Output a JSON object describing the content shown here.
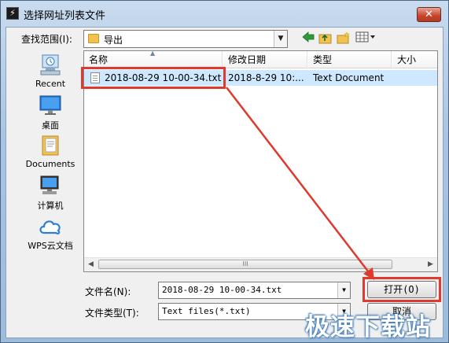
{
  "window": {
    "title": "选择网址列表文件",
    "close_glyph": "✕",
    "app_icon_glyph": "⚡"
  },
  "lookin": {
    "label": "查找范围(I):",
    "value": "导出"
  },
  "toolbar": {
    "back_icon": "back-arrow-icon",
    "up_icon": "up-folder-icon",
    "new_folder_icon": "new-folder-icon",
    "view_icon": "view-menu-icon"
  },
  "places": [
    {
      "label": "Recent",
      "icon": "recent-icon"
    },
    {
      "label": "桌面",
      "icon": "desktop-icon"
    },
    {
      "label": "Documents",
      "icon": "documents-icon"
    },
    {
      "label": "计算机",
      "icon": "computer-icon"
    },
    {
      "label": "WPS云文档",
      "icon": "cloud-icon"
    }
  ],
  "filelist": {
    "columns": [
      "名称",
      "修改日期",
      "类型",
      "大小"
    ],
    "rows": [
      {
        "name": "2018-08-29 10-00-34.txt",
        "modified": "2018-8-29 10:...",
        "type": "Text Document",
        "size": ""
      }
    ],
    "scroll_thumb_glyph": "III"
  },
  "filename": {
    "label": "文件名(N):",
    "value": "2018-08-29 10-00-34.txt"
  },
  "filetype": {
    "label": "文件类型(T):",
    "value": "Text files(*.txt)"
  },
  "buttons": {
    "open": "打开(O)",
    "cancel": "取消"
  },
  "watermark": "极速下载站",
  "colors": {
    "highlight": "#e0392e",
    "selection": "#cde8ff",
    "folder": "#f2c24f"
  }
}
